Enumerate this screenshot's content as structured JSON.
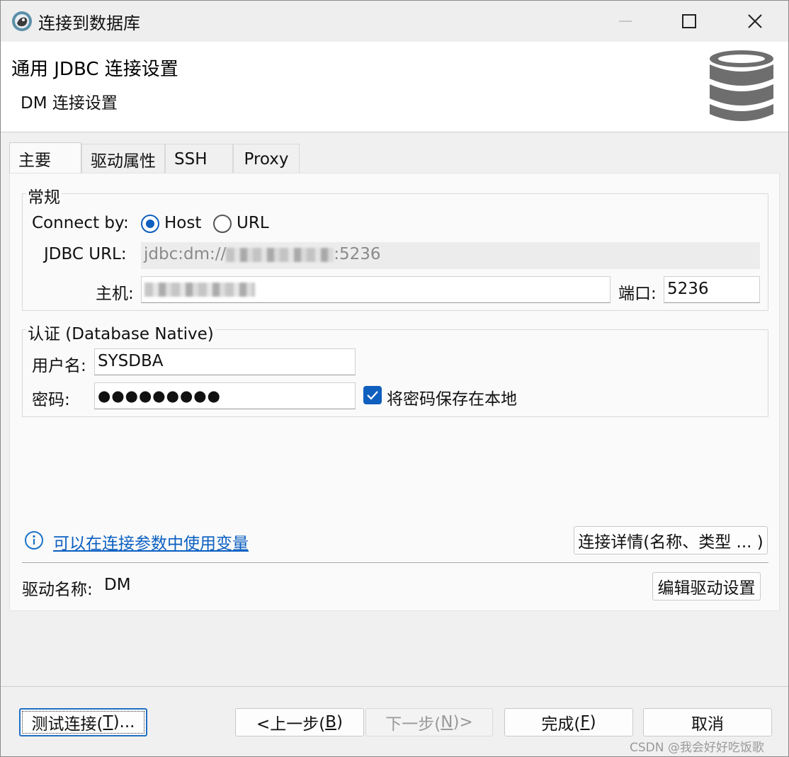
{
  "window": {
    "title": "连接到数据库"
  },
  "header": {
    "title": "通用 JDBC 连接设置",
    "subtitle": "DM 连接设置"
  },
  "tabs": [
    {
      "label": "主要",
      "active": true
    },
    {
      "label": "驱动属性",
      "active": false
    },
    {
      "label": "SSH",
      "active": false
    },
    {
      "label": "Proxy",
      "active": false
    }
  ],
  "general": {
    "group_title": "常规",
    "connect_by_label": "Connect by:",
    "option_host": "Host",
    "option_url": "URL",
    "selected": "Host",
    "jdbc_url_label": "JDBC URL:",
    "jdbc_url_prefix": "jdbc:dm://",
    "jdbc_url_suffix": ":5236",
    "host_label": "主机:",
    "port_label": "端口:",
    "port_value": "5236"
  },
  "auth": {
    "group_title": "认证 (Database Native)",
    "username_label": "用户名:",
    "username_value": "SYSDBA",
    "password_label": "密码:",
    "password_value": "●●●●●●●●●",
    "save_password_label": "将密码保存在本地",
    "save_password_checked": true
  },
  "info": {
    "variables_link": "可以在连接参数中使用变量",
    "details_button": "连接详情(名称、类型 ... )"
  },
  "driver": {
    "name_label": "驱动名称:",
    "name_value": "DM",
    "edit_button": "编辑驱动设置"
  },
  "footer": {
    "test_button_prefix": "测试连接(",
    "test_button_mnemonic": "T",
    "test_button_suffix": ")...",
    "back_button_prefix": "<上一步(",
    "back_button_mnemonic": "B",
    "back_button_suffix": ")",
    "next_button_prefix": "下一步(",
    "next_button_mnemonic": "N",
    "next_button_suffix": ")>",
    "finish_button_prefix": "完成(",
    "finish_button_mnemonic": "F",
    "finish_button_suffix": ")",
    "cancel_button": "取消"
  },
  "watermark": "CSDN @我会好好吃饭歌",
  "colors": {
    "accent": "#0f5fbf",
    "link": "#0b5fc1"
  }
}
